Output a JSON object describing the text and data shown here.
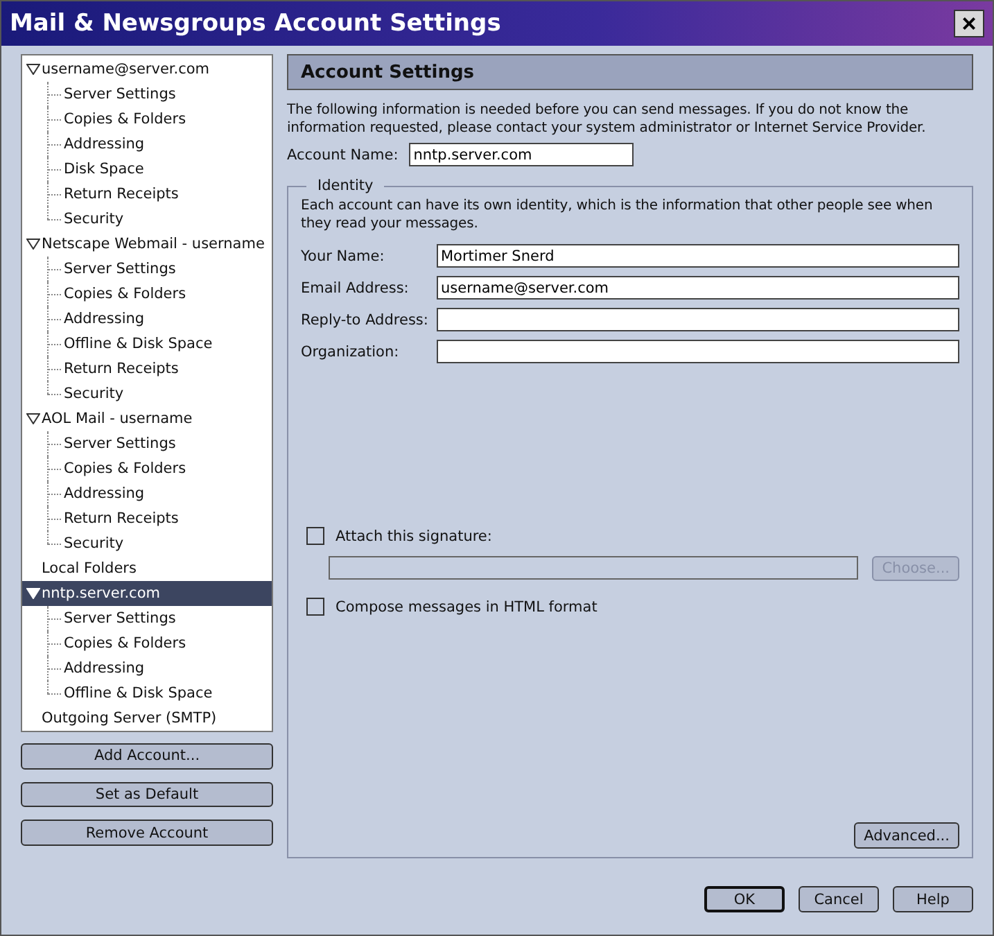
{
  "window": {
    "title": "Mail & Newsgroups Account Settings",
    "close_icon": "×"
  },
  "tree": [
    {
      "label": "username@server.com",
      "expanded": true,
      "selected": false,
      "children": [
        {
          "label": "Server Settings"
        },
        {
          "label": "Copies & Folders"
        },
        {
          "label": "Addressing"
        },
        {
          "label": "Disk Space"
        },
        {
          "label": "Return Receipts"
        },
        {
          "label": "Security"
        }
      ]
    },
    {
      "label": "Netscape Webmail - username",
      "expanded": true,
      "selected": false,
      "children": [
        {
          "label": "Server Settings"
        },
        {
          "label": "Copies & Folders"
        },
        {
          "label": "Addressing"
        },
        {
          "label": "Offline & Disk Space"
        },
        {
          "label": "Return Receipts"
        },
        {
          "label": "Security"
        }
      ]
    },
    {
      "label": "AOL Mail - username",
      "expanded": true,
      "selected": false,
      "children": [
        {
          "label": "Server Settings"
        },
        {
          "label": "Copies & Folders"
        },
        {
          "label": "Addressing"
        },
        {
          "label": "Return Receipts"
        },
        {
          "label": "Security"
        }
      ]
    },
    {
      "label": "Local Folders",
      "selected": false
    },
    {
      "label": "nntp.server.com",
      "expanded": true,
      "selected": true,
      "children": [
        {
          "label": "Server Settings"
        },
        {
          "label": "Copies & Folders"
        },
        {
          "label": "Addressing"
        },
        {
          "label": "Offline & Disk Space"
        }
      ]
    },
    {
      "label": "Outgoing Server (SMTP)",
      "selected": false
    }
  ],
  "account_buttons": [
    "Add Account...",
    "Set as Default",
    "Remove Account"
  ],
  "panel": {
    "title": "Account Settings",
    "intro": "The following information is needed before you can send messages. If you do not know the information requested, please contact your system administrator or Internet Service Provider.",
    "account_name": {
      "label": "Account Name:",
      "value": "nntp.server.com"
    },
    "identity": {
      "legend": "Identity",
      "description": "Each account can have its own identity, which is the information that other people see when they read your messages.",
      "fields": [
        {
          "label": "Your Name:",
          "value": "Mortimer Snerd"
        },
        {
          "label": "Email Address:",
          "value": "username@server.com"
        },
        {
          "label": "Reply-to Address:"
        },
        {
          "label": "Organization:"
        }
      ],
      "signature": {
        "label": "Attach this signature:",
        "checked": false,
        "choose_button": "Choose...",
        "disabled": true
      },
      "html_format": {
        "label": "Compose messages in HTML format",
        "checked": false
      },
      "advanced_button": "Advanced..."
    }
  },
  "dialog_buttons": [
    {
      "label": "OK",
      "default": true
    },
    {
      "label": "Cancel",
      "default": false
    },
    {
      "label": "Help",
      "default": false
    }
  ]
}
